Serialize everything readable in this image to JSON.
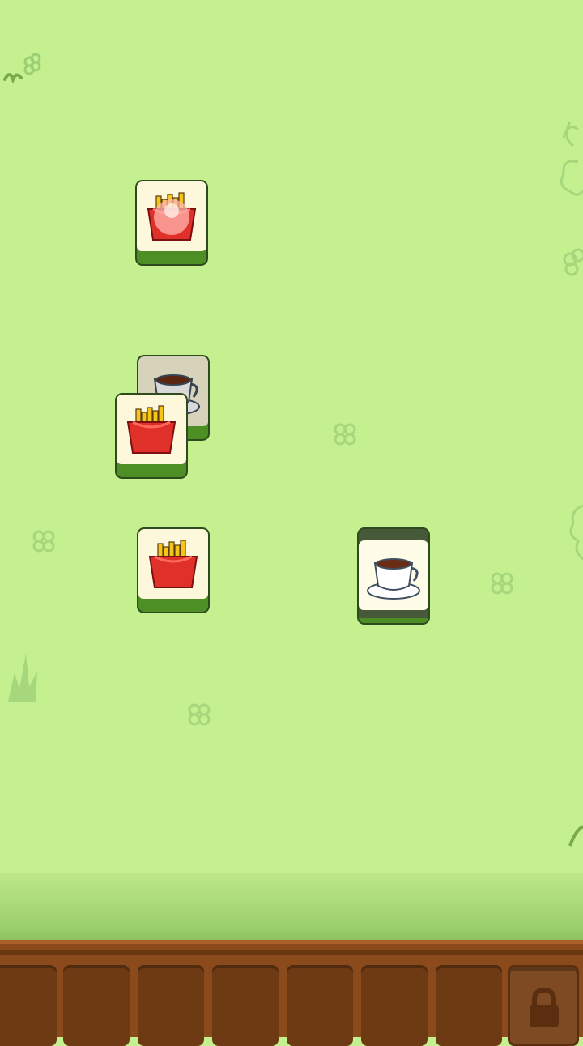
{
  "game": {
    "board": {
      "tiles": [
        {
          "icon": "fries-icon",
          "state": "selected-highlight"
        },
        {
          "icon": "coffee-cup-icon",
          "state": "covered"
        },
        {
          "icon": "fries-icon",
          "state": "free"
        },
        {
          "icon": "fries-icon",
          "state": "free"
        },
        {
          "icon": "coffee-cup-icon",
          "state": "free"
        }
      ]
    },
    "tray": {
      "slots": 7,
      "locked_slot_icon": "lock-icon"
    },
    "colors": {
      "background": "#c4f090",
      "tile_face": "#fdf8dc",
      "tile_base": "#4d8f24",
      "tray_wood": "#8a4a1c"
    }
  }
}
